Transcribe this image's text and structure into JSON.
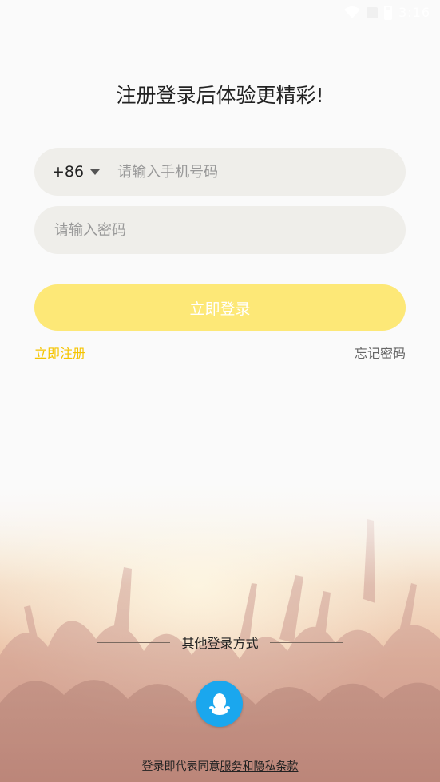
{
  "status_bar": {
    "time": "3:16",
    "icons": [
      "wifi-icon",
      "signal-icon",
      "battery-icon"
    ]
  },
  "title": "注册登录后体验更精彩!",
  "phone": {
    "country_code": "+86",
    "placeholder": "请输入手机号码",
    "value": ""
  },
  "password": {
    "placeholder": "请输入密码",
    "value": ""
  },
  "login_button": "立即登录",
  "register_link": "立即注册",
  "forgot_link": "忘记密码",
  "other_login": {
    "label": "其他登录方式",
    "options": [
      "qq-icon"
    ]
  },
  "agreement": {
    "prefix": "登录即代表同意",
    "link": "服务和隐私条款"
  },
  "colors": {
    "accent": "#fde877",
    "link_accent": "#f5c400",
    "qq_blue": "#1aa7ee",
    "input_bg": "#efeeea"
  }
}
